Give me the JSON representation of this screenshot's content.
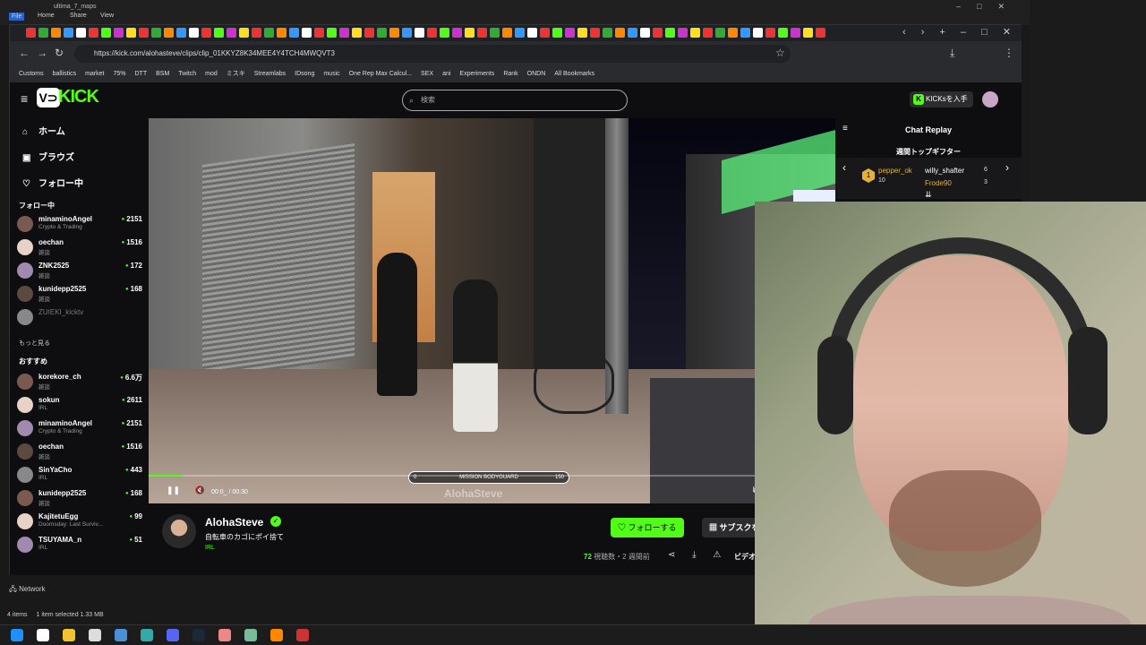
{
  "explorer": {
    "menu": [
      "File",
      "Home",
      "Share",
      "View"
    ],
    "window_title": "ultima_7_maps",
    "nav_item": "Network",
    "status": [
      "4 items",
      "1 item selected  1.33 MB"
    ]
  },
  "browser": {
    "url": "https://kick.com/alohasteve/clips/clip_01KKYZ8K34MEE4Y4TCH4MWQVT3",
    "bookmarks": [
      "Customs",
      "ballistics",
      "market",
      "75%",
      "DTT",
      "BSM",
      "Twitch",
      "mod",
      "ミスキ",
      "Streamlabs",
      "IDsong",
      "music",
      "One Rep Max Calcul...",
      "SEX",
      "ani",
      "Experiments",
      "Rank",
      "ONDN",
      "All Bookmarks"
    ],
    "colors": {
      "accent": "#53fc18",
      "bg": "#0e0e10"
    }
  },
  "kick": {
    "logo": "KICK",
    "search_placeholder": "検索",
    "kicks_button": "KICKsを入手",
    "nav": [
      {
        "icon": "home-icon",
        "glyph": "⌂",
        "label": "ホーム"
      },
      {
        "icon": "browse-icon",
        "glyph": "▣",
        "label": "ブラウズ"
      },
      {
        "icon": "heart-icon",
        "glyph": "♡",
        "label": "フォロー中"
      }
    ],
    "following_title": "フォロー中",
    "following": [
      {
        "name": "minaminoAngel",
        "category": "Crypto & Trading",
        "viewers": "2151"
      },
      {
        "name": "oechan",
        "category": "雑談",
        "viewers": "1516"
      },
      {
        "name": "ZNK2525",
        "category": "雑談",
        "viewers": "172"
      },
      {
        "name": "kunidepp2525",
        "category": "雑談",
        "viewers": "168"
      },
      {
        "name": "ZUIEKI_kicktv",
        "category": "",
        "viewers": ""
      }
    ],
    "show_more": "もっと見る",
    "recommended_title": "おすすめ",
    "recommended": [
      {
        "name": "korekore_ch",
        "category": "雑談",
        "viewers": "6.6万"
      },
      {
        "name": "sokun",
        "category": "IRL",
        "viewers": "2611"
      },
      {
        "name": "minaminoAngel",
        "category": "Crypto & Trading",
        "viewers": "2151"
      },
      {
        "name": "oechan",
        "category": "雑談",
        "viewers": "1516"
      },
      {
        "name": "SinYaCho",
        "category": "IRL",
        "viewers": "443"
      },
      {
        "name": "kunidepp2525",
        "category": "雑談",
        "viewers": "168"
      },
      {
        "name": "KajitetuEgg",
        "category": "Doomsday: Last Surviv...",
        "viewers": "99"
      },
      {
        "name": "TSUYAMA_n",
        "category": "IRL",
        "viewers": "51"
      }
    ],
    "player": {
      "time": "00:0_ / 00:30",
      "progress": 0.05,
      "overlay_title": "MISSION BODYGUARD",
      "overlay_left": "0",
      "overlay_right": "150",
      "overlay_name": "AlohaSteve"
    },
    "streamer": {
      "name": "AlohaSteve",
      "clip_title": "自転車のカゴにポイ捨て",
      "category": "IRL",
      "follow": "フォローする",
      "subscribe": "サブスクを贈る",
      "register": "登録",
      "views_count": "72",
      "views_label": "視聴数・2 週間前",
      "video_full": "ビデオ全"
    },
    "chat": {
      "title": "Chat Replay",
      "gifter_title": "週間トップギフター",
      "top": {
        "rank": "1",
        "name": "pepper_ok",
        "count": "10"
      },
      "others": [
        {
          "name": "willy_shafter",
          "count": "6"
        },
        {
          "name": "Frode90",
          "count": "3"
        }
      ]
    }
  }
}
